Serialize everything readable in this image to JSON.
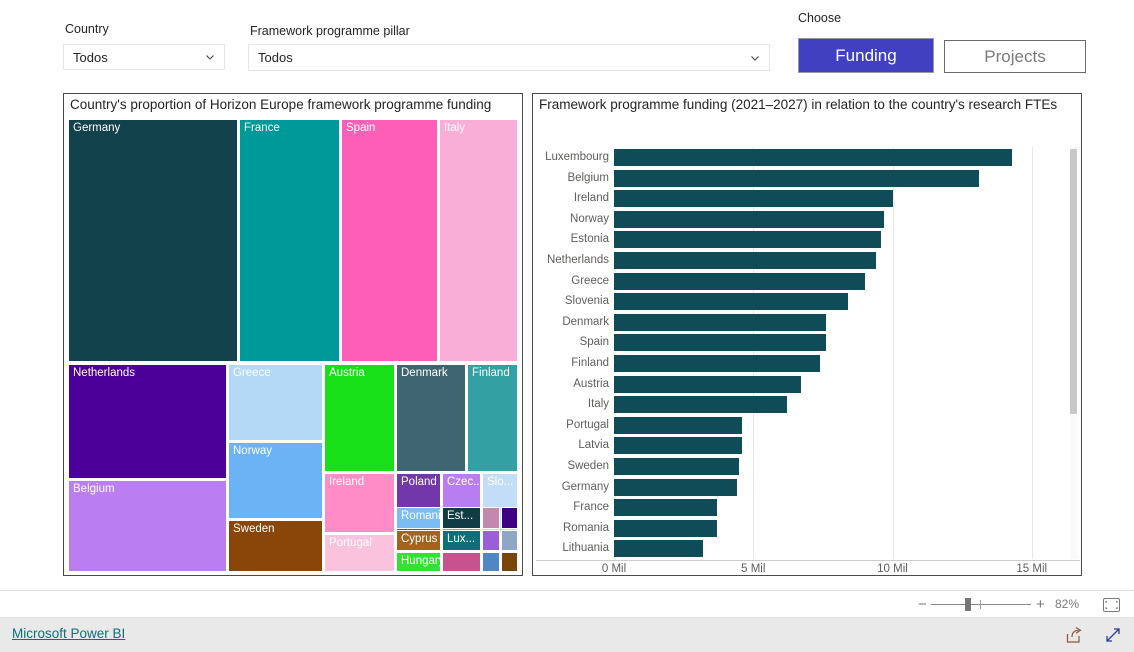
{
  "filters": {
    "country": {
      "label": "Country",
      "value": "Todos",
      "chevron_icon": "chevron-down-icon"
    },
    "pillar": {
      "label": "Framework programme pillar",
      "value": "Todos",
      "chevron_icon": "chevron-down-icon"
    }
  },
  "choose": {
    "label": "Choose",
    "funding_label": "Funding",
    "projects_label": "Projects",
    "active": "Funding",
    "active_color": "#4040c0",
    "inactive_text_color": "#7b7b7b"
  },
  "treemap": {
    "title": "Country's proportion of Horizon Europe framework programme funding"
  },
  "barchart": {
    "title": "Framework programme funding (2021–2027) in relation to the country's research FTEs"
  },
  "statusbar": {
    "zoom_minus": "−",
    "zoom_plus": "+",
    "zoom_percent": "82%",
    "fit_icon": "fit-to-page-icon"
  },
  "footer": {
    "link": "Microsoft Power BI",
    "share_icon": "share-icon",
    "expand_icon": "fullscreen-icon"
  },
  "chart_data": [
    {
      "type": "treemap",
      "title": "Country's proportion of Horizon Europe framework programme funding",
      "legend": "none",
      "tiles": [
        {
          "label": "Germany",
          "color": "#12434c",
          "text": "light"
        },
        {
          "label": "France",
          "color": "#009999",
          "text": "light"
        },
        {
          "label": "Spain",
          "color": "#fc5fb5",
          "text": "light"
        },
        {
          "label": "Italy",
          "color": "#f9aed7",
          "text": "light"
        },
        {
          "label": "Netherlands",
          "color": "#4c0099",
          "text": "light"
        },
        {
          "label": "Greece",
          "color": "#b3d9f7",
          "text": "light"
        },
        {
          "label": "Austria",
          "color": "#18e018",
          "text": "light"
        },
        {
          "label": "Denmark",
          "color": "#3f6670",
          "text": "light"
        },
        {
          "label": "Finland",
          "color": "#33a0a3",
          "text": "light"
        },
        {
          "label": "Norway",
          "color": "#6cb3f5",
          "text": "light"
        },
        {
          "label": "Ireland",
          "color": "#ff8cc6",
          "text": "light"
        },
        {
          "label": "Poland",
          "color": "#7238ab",
          "text": "light"
        },
        {
          "label": "Czec...",
          "color": "#b87ef0",
          "text": "light"
        },
        {
          "label": "Slo...",
          "color": "#c3ddf7",
          "text": "light"
        },
        {
          "label": "Belgium",
          "color": "#bb7ef0",
          "text": "light"
        },
        {
          "label": "Sweden",
          "color": "#8a4508",
          "text": "light"
        },
        {
          "label": "Portugal",
          "color": "#fbc2dd",
          "text": "light"
        },
        {
          "label": "Romania",
          "color": "#7cbcf5",
          "text": "light"
        },
        {
          "label": "Est...",
          "color": "#103d45",
          "text": "light"
        },
        {
          "label": "",
          "color": "#c288ae",
          "text": "light"
        },
        {
          "label": "",
          "color": "#3d0080",
          "text": "light"
        },
        {
          "label": "Cyprus",
          "color": "#a06620",
          "text": "light"
        },
        {
          "label": "Lux...",
          "color": "#0f6e78",
          "text": "light"
        },
        {
          "label": "",
          "color": "#9a5fd6",
          "text": "light"
        },
        {
          "label": "",
          "color": "#8fa6c4",
          "text": "light"
        },
        {
          "label": "Hungary",
          "color": "#33e033",
          "text": "light"
        },
        {
          "label": "",
          "color": "#c4538f",
          "text": "light"
        },
        {
          "label": "",
          "color": "#5086c4",
          "text": "light"
        },
        {
          "label": "",
          "color": "#7a4508",
          "text": "light"
        }
      ]
    },
    {
      "type": "bar",
      "orientation": "horizontal",
      "title": "Framework programme funding (2021–2027) in relation to the country's research FTEs",
      "xlabel": "",
      "ylabel": "",
      "xlim": [
        0,
        17
      ],
      "xticks": [
        0,
        5,
        10,
        15
      ],
      "xtick_labels": [
        "0 Mil",
        "5 Mil",
        "10 Mil",
        "15 Mil"
      ],
      "grid": true,
      "bar_color": "#0f4c58",
      "unit": "Mil",
      "categories": [
        "Luxembourg",
        "Belgium",
        "Ireland",
        "Norway",
        "Estonia",
        "Netherlands",
        "Greece",
        "Slovenia",
        "Denmark",
        "Spain",
        "Finland",
        "Austria",
        "Italy",
        "Portugal",
        "Latvia",
        "Sweden",
        "Germany",
        "France",
        "Romania",
        "Lithuania"
      ],
      "values": [
        14.3,
        13.1,
        10.0,
        9.7,
        9.6,
        9.4,
        9.0,
        8.4,
        7.6,
        7.6,
        7.4,
        6.7,
        6.2,
        4.6,
        4.6,
        4.5,
        4.4,
        3.7,
        3.7,
        3.2
      ]
    }
  ]
}
